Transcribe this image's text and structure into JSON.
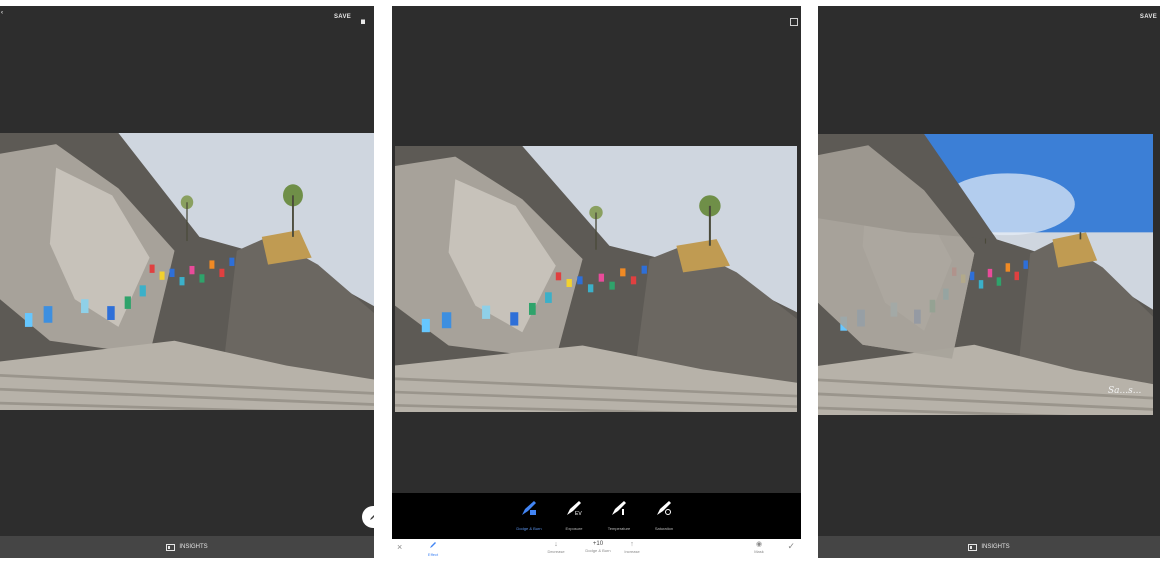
{
  "left_panel": {
    "save_label": "SAVE",
    "insights_label": "INSIGHTS",
    "icons": [
      "back-icon",
      "hand-icon",
      "edit-icon",
      "insights-icon"
    ]
  },
  "middle_panel": {
    "tools": [
      {
        "label": "Dodge & Burn",
        "icon": "brush-dodge-icon",
        "active": true
      },
      {
        "label": "Exposure",
        "icon": "brush-ev-icon",
        "active": false
      },
      {
        "label": "Temperature",
        "icon": "brush-temperature-icon",
        "active": false
      },
      {
        "label": "Saturation",
        "icon": "brush-saturation-icon",
        "active": false
      }
    ],
    "bottom": {
      "close_icon": "close-icon",
      "effect_label": "Effect",
      "decrease_label": "Decrease",
      "value": "+10",
      "value_label": "Dodge & Burn",
      "increase_label": "Increase",
      "mask_label": "Mask",
      "apply_icon": "check-icon"
    },
    "compare_icon": "compare-icon"
  },
  "right_panel": {
    "save_label": "SAVE",
    "insights_label": "INSIGHTS",
    "signature": "Sa...s..."
  },
  "colors": {
    "accent": "#4285f4",
    "panel_bg": "#2d2d2d",
    "bar_bg": "#454545"
  }
}
